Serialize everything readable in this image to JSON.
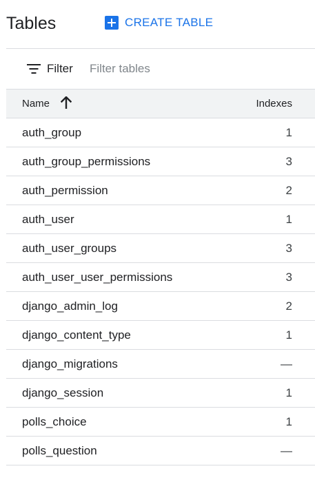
{
  "header": {
    "title": "Tables",
    "create_label": "CREATE TABLE"
  },
  "filter": {
    "label": "Filter",
    "placeholder": "Filter tables"
  },
  "table": {
    "columns": {
      "name": "Name",
      "indexes": "Indexes"
    },
    "sort": {
      "column": "Name",
      "direction": "ascending"
    },
    "rows": [
      {
        "name": "auth_group",
        "indexes": "1"
      },
      {
        "name": "auth_group_permissions",
        "indexes": "3"
      },
      {
        "name": "auth_permission",
        "indexes": "2"
      },
      {
        "name": "auth_user",
        "indexes": "1"
      },
      {
        "name": "auth_user_groups",
        "indexes": "3"
      },
      {
        "name": "auth_user_user_permissions",
        "indexes": "3"
      },
      {
        "name": "django_admin_log",
        "indexes": "2"
      },
      {
        "name": "django_content_type",
        "indexes": "1"
      },
      {
        "name": "django_migrations",
        "indexes": "—"
      },
      {
        "name": "django_session",
        "indexes": "1"
      },
      {
        "name": "polls_choice",
        "indexes": "1"
      },
      {
        "name": "polls_question",
        "indexes": "—"
      }
    ]
  },
  "colors": {
    "accent": "#1a73e8",
    "header_bg": "#f1f3f4",
    "divider": "#dadce0",
    "text": "#202124"
  }
}
